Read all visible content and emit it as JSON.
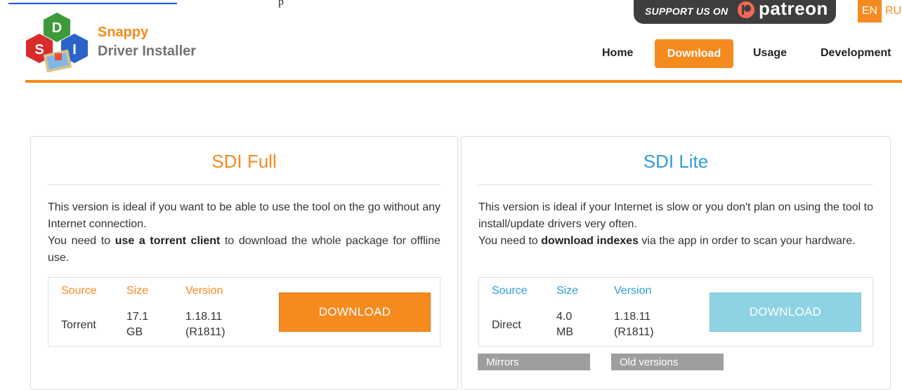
{
  "header": {
    "brand_name": "Snappy",
    "brand_sub": "Driver Installer",
    "patreon_text": "SUPPORT US ON",
    "patreon_word": "patreon",
    "lang_active": "EN",
    "lang_other": "RU",
    "top_fragment": "p"
  },
  "nav": {
    "home": "Home",
    "download": "Download",
    "usage": "Usage",
    "development": "Development"
  },
  "colors": {
    "accent": "#f58a1f",
    "lite": "#2d9fd4",
    "lite_button": "#8ed3e3"
  },
  "full": {
    "title": "SDI Full",
    "desc_1": "This version is ideal if you want to be able to use the tool on the go without any Internet connection.",
    "desc_2a": "You need to ",
    "desc_2b": "use a torrent client",
    "desc_2c": " to download the whole package for offline use.",
    "headers": {
      "source": "Source",
      "size": "Size",
      "version": "Version"
    },
    "source": "Torrent",
    "size_1": "17.1",
    "size_2": "GB",
    "version_1": "1.18.11",
    "version_2": "(R1811)",
    "button": "DOWNLOAD"
  },
  "lite": {
    "title": "SDI Lite",
    "desc_1": "This version is ideal if your Internet is slow or you don't plan on using the tool to install/update drivers very often.",
    "desc_2a": "You need to ",
    "desc_2b": "download indexes",
    "desc_2c": " via the app in order to scan your hardware.",
    "headers": {
      "source": "Source",
      "size": "Size",
      "version": "Version"
    },
    "source": "Direct",
    "size_1": "4.0",
    "size_2": "MB",
    "version_1": "1.18.11",
    "version_2": "(R1811)",
    "button": "DOWNLOAD",
    "mirrors": "Mirrors",
    "old_versions": "Old versions"
  }
}
